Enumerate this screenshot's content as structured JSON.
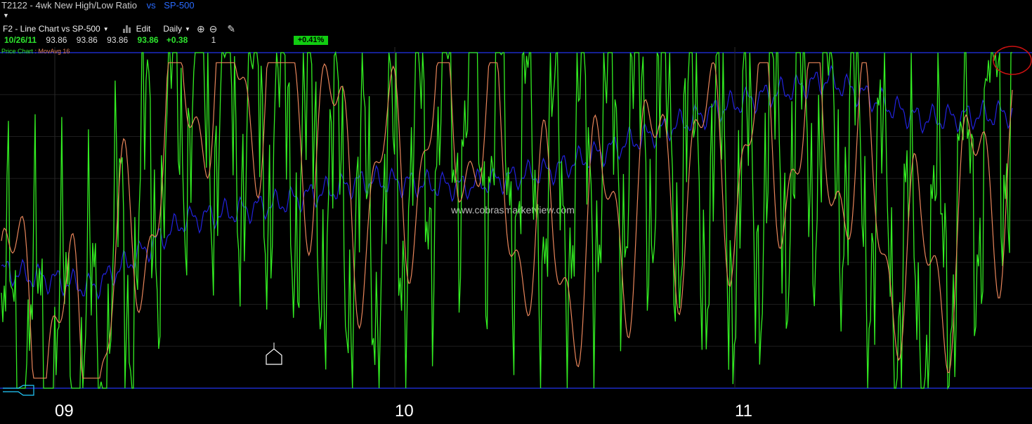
{
  "header": {
    "symbol": "T2122",
    "dash": "-",
    "indicator": "4wk New High/Low Ratio",
    "vs": "vs",
    "benchmark": "SP-500"
  },
  "toolbar": {
    "layout_label": "F2 - Line Chart vs SP-500",
    "edit_label": "Edit",
    "period_label": "Daily"
  },
  "quote": {
    "date": "10/26/11",
    "open": "93.86",
    "high": "93.86",
    "low": "93.86",
    "last": "93.86",
    "change": "+0.38",
    "count": "1",
    "pct_change": "+0.41%"
  },
  "legend": {
    "price_label": "Price Chart",
    "ma_label": ": MovAvg 16"
  },
  "watermark": "www.cobrasmarketview.com",
  "colors": {
    "indicator": "#33ee22",
    "moving_average": "#e8855a",
    "sp500": "#2222dd",
    "reference_lines": "#2233ee",
    "annotation_circle": "#cc1111"
  },
  "chart_data": {
    "type": "line",
    "x_tick_labels": [
      "09",
      "10",
      "11"
    ],
    "x": [
      "2009-01",
      "2009-04",
      "2009-07",
      "2009-10",
      "2010-01",
      "2010-04",
      "2010-07",
      "2010-10",
      "2011-01",
      "2011-04",
      "2011-07",
      "2011-10"
    ],
    "ylim": [
      0,
      100
    ],
    "grid": true,
    "series": [
      {
        "name": "Price Chart",
        "values": [
          12,
          8,
          92,
          78,
          45,
          88,
          60,
          80,
          55,
          85,
          25,
          95
        ],
        "color": "#33ee22"
      },
      {
        "name": "MovAvg 16",
        "values": [
          30,
          5,
          92,
          95,
          55,
          85,
          35,
          60,
          70,
          78,
          30,
          75
        ],
        "color": "#e8855a"
      },
      {
        "values": [
          35,
          30,
          50,
          55,
          62,
          60,
          65,
          75,
          85,
          92,
          80,
          82
        ],
        "color": "#2222dd"
      }
    ],
    "annotation": "circled latest reading"
  }
}
